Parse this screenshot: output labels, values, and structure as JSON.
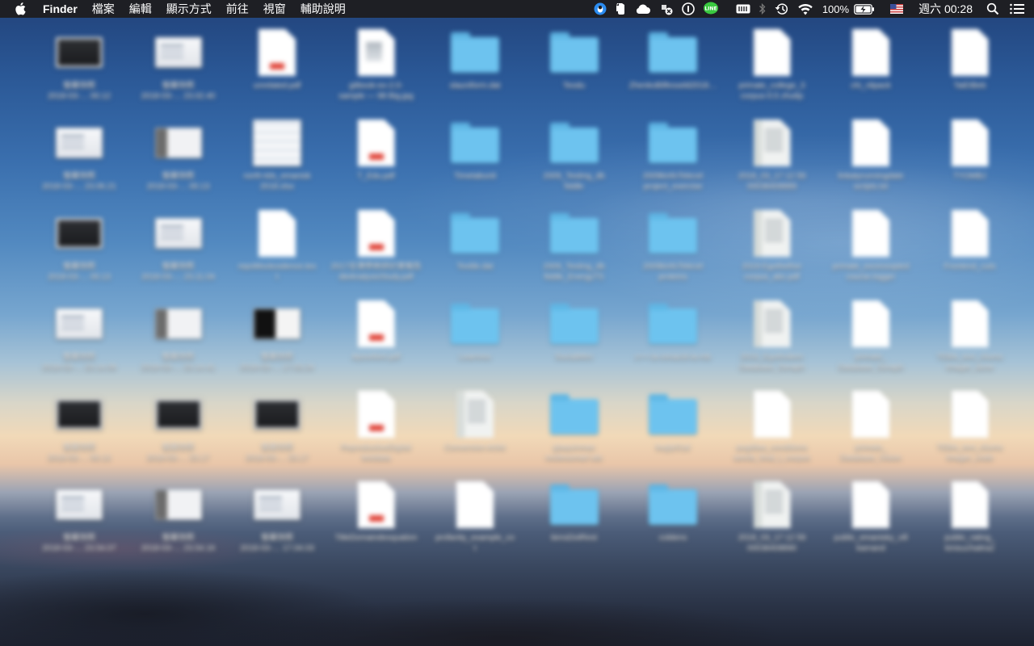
{
  "menubar": {
    "apple_icon": "apple-logo-icon",
    "app_name": "Finder",
    "menus": [
      "檔案",
      "編輯",
      "顯示方式",
      "前往",
      "視窗",
      "輔助說明"
    ],
    "battery_percent": "100%",
    "clock": "週六 00:28",
    "tray_icons": [
      "qq-icon",
      "evernote-icon",
      "cloud-icon",
      "sync-icon",
      "onepassword-icon",
      "line-icon",
      "memory-icon",
      "bluetooth-icon",
      "time-machine-icon",
      "wifi-icon",
      "battery-icon",
      "input-source-flag-icon",
      "spotlight-search-icon",
      "notification-center-icon"
    ]
  },
  "desktop": {
    "items": [
      {
        "type": "thumb-dark",
        "label": "螢幕快照\n2018-03-… 00.12"
      },
      {
        "type": "thumb-light",
        "label": "螢幕快照\n2018-03-… 23.02.40"
      },
      {
        "type": "pdf",
        "label": "unrelated.pdf"
      },
      {
        "type": "tex",
        "label": "gitbook-ex-2.0-\nsample — 98 Big.jpg"
      },
      {
        "type": "folder",
        "label": "slauniform.dat"
      },
      {
        "type": "folder",
        "label": "Teodu"
      },
      {
        "type": "folder",
        "label": "ZhenkoBilfesseld2018…"
      },
      {
        "type": "doc",
        "label": "primate_college_3\ncorpus-0.5 zhuttp"
      },
      {
        "type": "doc",
        "label": "chi_nlipack"
      },
      {
        "type": "doc",
        "label": "TaiEtBeb"
      },
      {
        "type": "thumb-light",
        "label": "螢幕快照\n2018-03-… 23.06.21"
      },
      {
        "type": "thumb-mixed",
        "label": "螢幕快照\n2018-03-… 00.13"
      },
      {
        "type": "sheet",
        "label": "north-kils_emanisk\n2018.xlsx"
      },
      {
        "type": "pdf",
        "label": "T_Edu.pdf"
      },
      {
        "type": "folder",
        "label": "Timetabunit"
      },
      {
        "type": "folder",
        "label": "2009_Testing_db\nfiddle"
      },
      {
        "type": "folder",
        "label": "2009kinfoTelecel\nproject_exercise"
      },
      {
        "type": "scan",
        "label": "2018_03_17 12 59\n00038408889"
      },
      {
        "type": "doc",
        "label": "linkatyrunningdate\nscripts.txt"
      },
      {
        "type": "doc",
        "label": "TYOMBJ"
      },
      {
        "type": "thumb-dark",
        "label": "螢幕快照\n2018-03-… 00.13"
      },
      {
        "type": "thumb-light",
        "label": "螢幕快照\n2018-03-… 23.11.04"
      },
      {
        "type": "doc",
        "label": "repoMockosilence.tex\nt"
      },
      {
        "type": "pdf",
        "label": "2017全港學術研討會報告\ndieAnalysisStudy.pdf"
      },
      {
        "type": "folder",
        "label": "Textile.dat"
      },
      {
        "type": "folder",
        "label": "2009_Testing_db\nfiddle_EnergyTS"
      },
      {
        "type": "folder",
        "label": "2009kinfoTelecel\nproteins"
      },
      {
        "type": "scan",
        "label": "2019 Egothether\ncorpus_abc.pdf"
      },
      {
        "type": "doc",
        "label": "primate_excessopted\ncourse.logger"
      },
      {
        "type": "doc",
        "label": "Frontend_cuts"
      },
      {
        "type": "thumb-light",
        "label": "螢幕快照\n2018-03-… 23.14.09"
      },
      {
        "type": "thumb-mixed",
        "label": "螢幕快照\n2018-03-… 23.14.41"
      },
      {
        "type": "thumb-blackwhite",
        "label": "螢幕快照\n2018-03-… 17.03.24"
      },
      {
        "type": "pdf",
        "label": "ApsoAlert.pdf"
      },
      {
        "type": "folder",
        "label": "Learnrex"
      },
      {
        "type": "folder",
        "label": "SocialMtm"
      },
      {
        "type": "folder",
        "label": "c++-ia-cenacid-ia-mb"
      },
      {
        "type": "scan",
        "label": "2019_Egotholiem\nDatabase_Seraph"
      },
      {
        "type": "doc",
        "label": "primate_\nDatabase_Seraph"
      },
      {
        "type": "doc",
        "label": "TEBA_text_cliums\nImager_dune"
      },
      {
        "type": "thumb-dark",
        "label": "螢幕快照\n2018-03-… 00.13"
      },
      {
        "type": "thumb-dark",
        "label": "螢幕快照\n2018-03-… 23.17"
      },
      {
        "type": "thumb-dark",
        "label": "螢幕快照\n2018-03-… 23.17"
      },
      {
        "type": "pdf",
        "label": "ReproductiveDigital\ntestdata"
      },
      {
        "type": "scan",
        "label": "Conversion Artist"
      },
      {
        "type": "folder",
        "label": "gtaquinmas\nrestlessmart ats"
      },
      {
        "type": "folder",
        "label": "bugly01al"
      },
      {
        "type": "doc",
        "label": "pugdlaw_conditions\nwords_final_t_corpus"
      },
      {
        "type": "doc",
        "label": "primate_\nDatabase_Vision"
      },
      {
        "type": "doc",
        "label": "TEBA_text_cliums\nImager_code"
      },
      {
        "type": "thumb-light",
        "label": "螢幕快照\n2018-03-… 23.54.07"
      },
      {
        "type": "thumb-mixed",
        "label": "螢幕快照\n2018-03-… 23.54.16"
      },
      {
        "type": "thumb-light",
        "label": "螢幕快照\n2018-03-… 17.04.03"
      },
      {
        "type": "pdf",
        "label": "TitleDomaindexquation"
      },
      {
        "type": "doc",
        "label": "profanity_example_co\nt"
      },
      {
        "type": "folder",
        "label": "tiensDotRest"
      },
      {
        "type": "folder",
        "label": "coldens"
      },
      {
        "type": "scan",
        "label": "2018_03_17 12 59\n00038408890"
      },
      {
        "type": "doc",
        "label": "public_emanisky_vill\nkamand"
      },
      {
        "type": "doc",
        "label": "public_rating_\nkinisuchaitra2"
      }
    ]
  }
}
